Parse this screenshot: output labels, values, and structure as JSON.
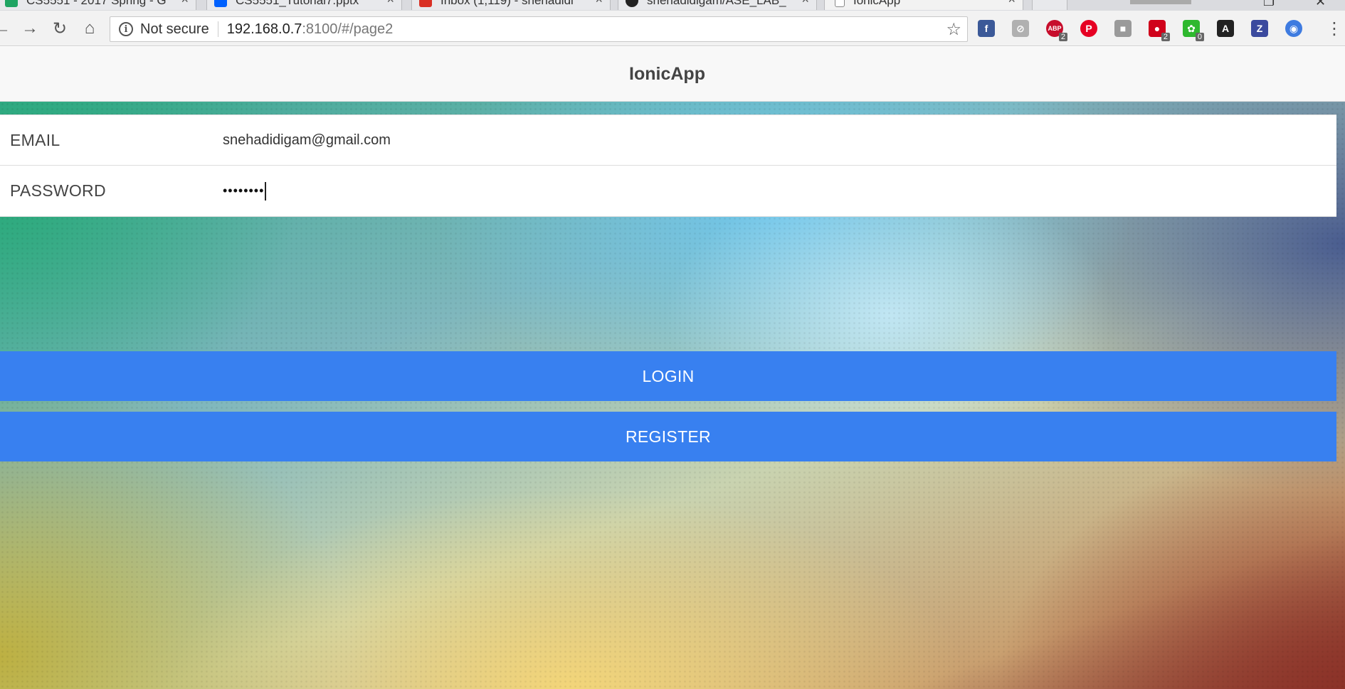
{
  "browser": {
    "tabs": [
      {
        "title": "CS5551 - 2017 Spring - G",
        "favicon_color": "#1fa463",
        "active": false
      },
      {
        "title": "CS5551_Tutorial7.pptx",
        "favicon_color": "#0061fe",
        "active": false
      },
      {
        "title": "Inbox (1,119) - snehadidi",
        "favicon_color": "#d93025",
        "active": false
      },
      {
        "title": "snehadidigam/ASE_LAB_",
        "favicon_color": "#222222",
        "active": false
      },
      {
        "title": "IonicApp",
        "favicon_color": "#888888",
        "active": true
      }
    ],
    "tab_close_glyph": "×",
    "window_controls": {
      "restore": "❐",
      "close": "✕"
    },
    "nav": {
      "back": "←",
      "forward": "→",
      "reload": "↻",
      "home": "⌂"
    },
    "address": {
      "security_label": "Not secure",
      "info_glyph": "i",
      "host": "192.168.0.7",
      "path": ":8100/#/page2",
      "star_glyph": "☆"
    },
    "extensions": [
      {
        "name": "facebook-ext-icon",
        "glyph": "f",
        "color": "#3b5998",
        "badge": ""
      },
      {
        "name": "generic-ext-icon",
        "glyph": "⊘",
        "color": "#b0b0b0",
        "badge": ""
      },
      {
        "name": "adblock-plus-icon",
        "glyph": "ABP",
        "color": "#c70d2c",
        "badge": "2"
      },
      {
        "name": "pinterest-icon",
        "glyph": "P",
        "color": "#e60023",
        "badge": ""
      },
      {
        "name": "gray-ext-icon",
        "glyph": "■",
        "color": "#9a9a9a",
        "badge": ""
      },
      {
        "name": "red-ext-icon",
        "glyph": "●",
        "color": "#d0021b",
        "badge": "2"
      },
      {
        "name": "green-ext-icon",
        "glyph": "✿",
        "color": "#2eb82e",
        "badge": "0"
      },
      {
        "name": "font-ext-icon",
        "glyph": "A",
        "color": "#222222",
        "badge": ""
      },
      {
        "name": "zotero-icon",
        "glyph": "Z",
        "color": "#3b4a9e",
        "badge": ""
      },
      {
        "name": "blue-ext-icon",
        "glyph": "◉",
        "color": "#3e7be0",
        "badge": ""
      }
    ],
    "menu_glyph": "⋮"
  },
  "app": {
    "title": "IonicApp",
    "form": {
      "email_label": "EMAIL",
      "email_value": "snehadidigam@gmail.com",
      "password_label": "PASSWORD",
      "password_value": "••••••••"
    },
    "buttons": {
      "login": "LOGIN",
      "register": "REGISTER"
    },
    "accent_color": "#3880f0"
  }
}
